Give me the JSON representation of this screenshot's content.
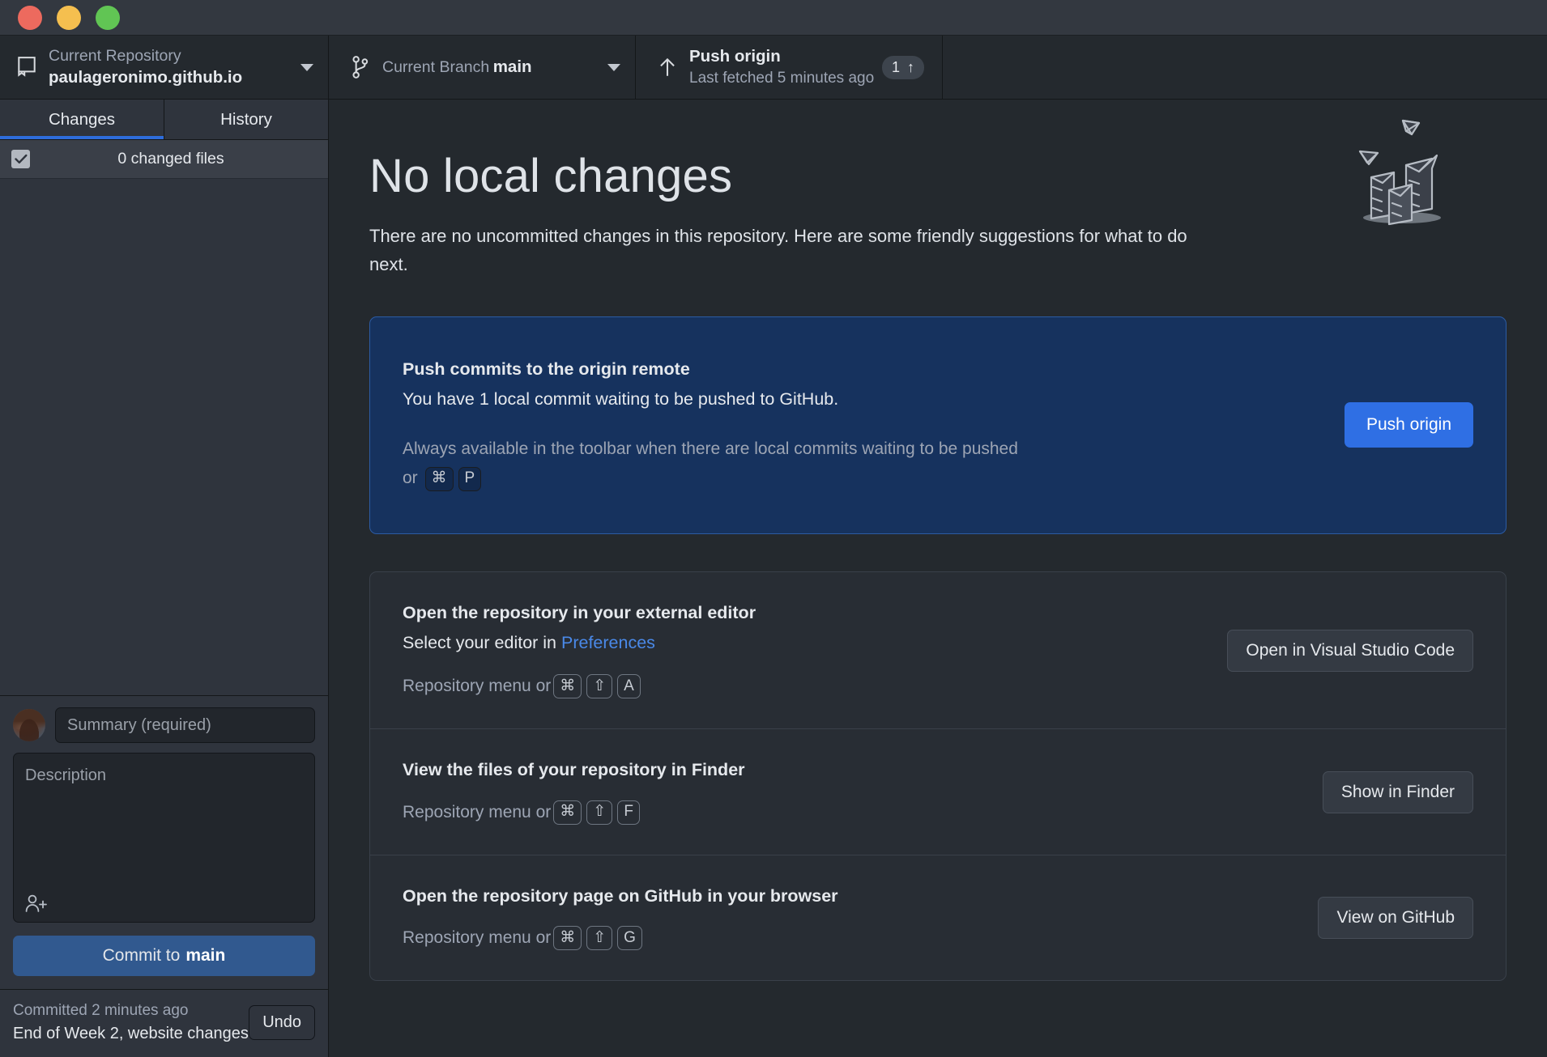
{
  "titlebar": {
    "close": "close",
    "minimize": "minimize",
    "maximize": "maximize"
  },
  "toolbar": {
    "repository": {
      "label": "Current Repository",
      "value": "paulageronimo.github.io",
      "icon": "repo-icon"
    },
    "branch": {
      "label": "Current Branch",
      "value": "main",
      "icon": "branch-icon"
    },
    "push": {
      "label": "Push origin",
      "sub": "Last fetched 5 minutes ago",
      "icon": "arrow-up-icon",
      "badge_count": "1",
      "badge_arrow": "↑"
    }
  },
  "sidebar": {
    "tabs": [
      {
        "label": "Changes",
        "active": true
      },
      {
        "label": "History",
        "active": false
      }
    ],
    "changed_files_label": "0 changed files",
    "commit": {
      "summary_placeholder": "Summary (required)",
      "summary_value": "",
      "description_placeholder": "Description",
      "description_value": "",
      "coauthor_icon": "add-coauthor-icon",
      "button_prefix": "Commit to ",
      "button_branch": "main"
    },
    "undo": {
      "time": "Committed 2 minutes ago",
      "message": "End of Week 2, website changes",
      "button": "Undo"
    }
  },
  "main": {
    "title": "No local changes",
    "description": "There are no uncommitted changes in this repository. Here are some friendly suggestions for what to do next.",
    "illustration": "boxes-and-paper-planes-illustration",
    "cards": [
      {
        "title": "Push commits to the origin remote",
        "description": "You have 1 local commit waiting to be pushed to GitHub.",
        "hint_prefix": "Always available in the toolbar when there are local commits waiting to be pushed or ",
        "keys": [
          "⌘",
          "P"
        ],
        "button": "Push origin",
        "highlight_color": "#16325e",
        "button_color": "#2f6fe4"
      },
      {
        "title": "Open the repository in your external editor",
        "description_prefix": "Select your editor in ",
        "description_link": "Preferences",
        "hint_prefix": "Repository menu or ",
        "keys": [
          "⌘",
          "⇧",
          "A"
        ],
        "button": "Open in Visual Studio Code"
      },
      {
        "title": "View the files of your repository in Finder",
        "hint_prefix": "Repository menu or ",
        "keys": [
          "⌘",
          "⇧",
          "F"
        ],
        "button": "Show in Finder"
      },
      {
        "title": "Open the repository page on GitHub in your browser",
        "hint_prefix": "Repository menu or ",
        "keys": [
          "⌘",
          "⇧",
          "G"
        ],
        "button": "View on GitHub"
      }
    ]
  },
  "colors": {
    "accent": "#2e6ddc",
    "commit_button": "#31598f",
    "link": "#4a89e8",
    "app_bg": "#24292e",
    "sidebar_bg": "#2f343d"
  }
}
